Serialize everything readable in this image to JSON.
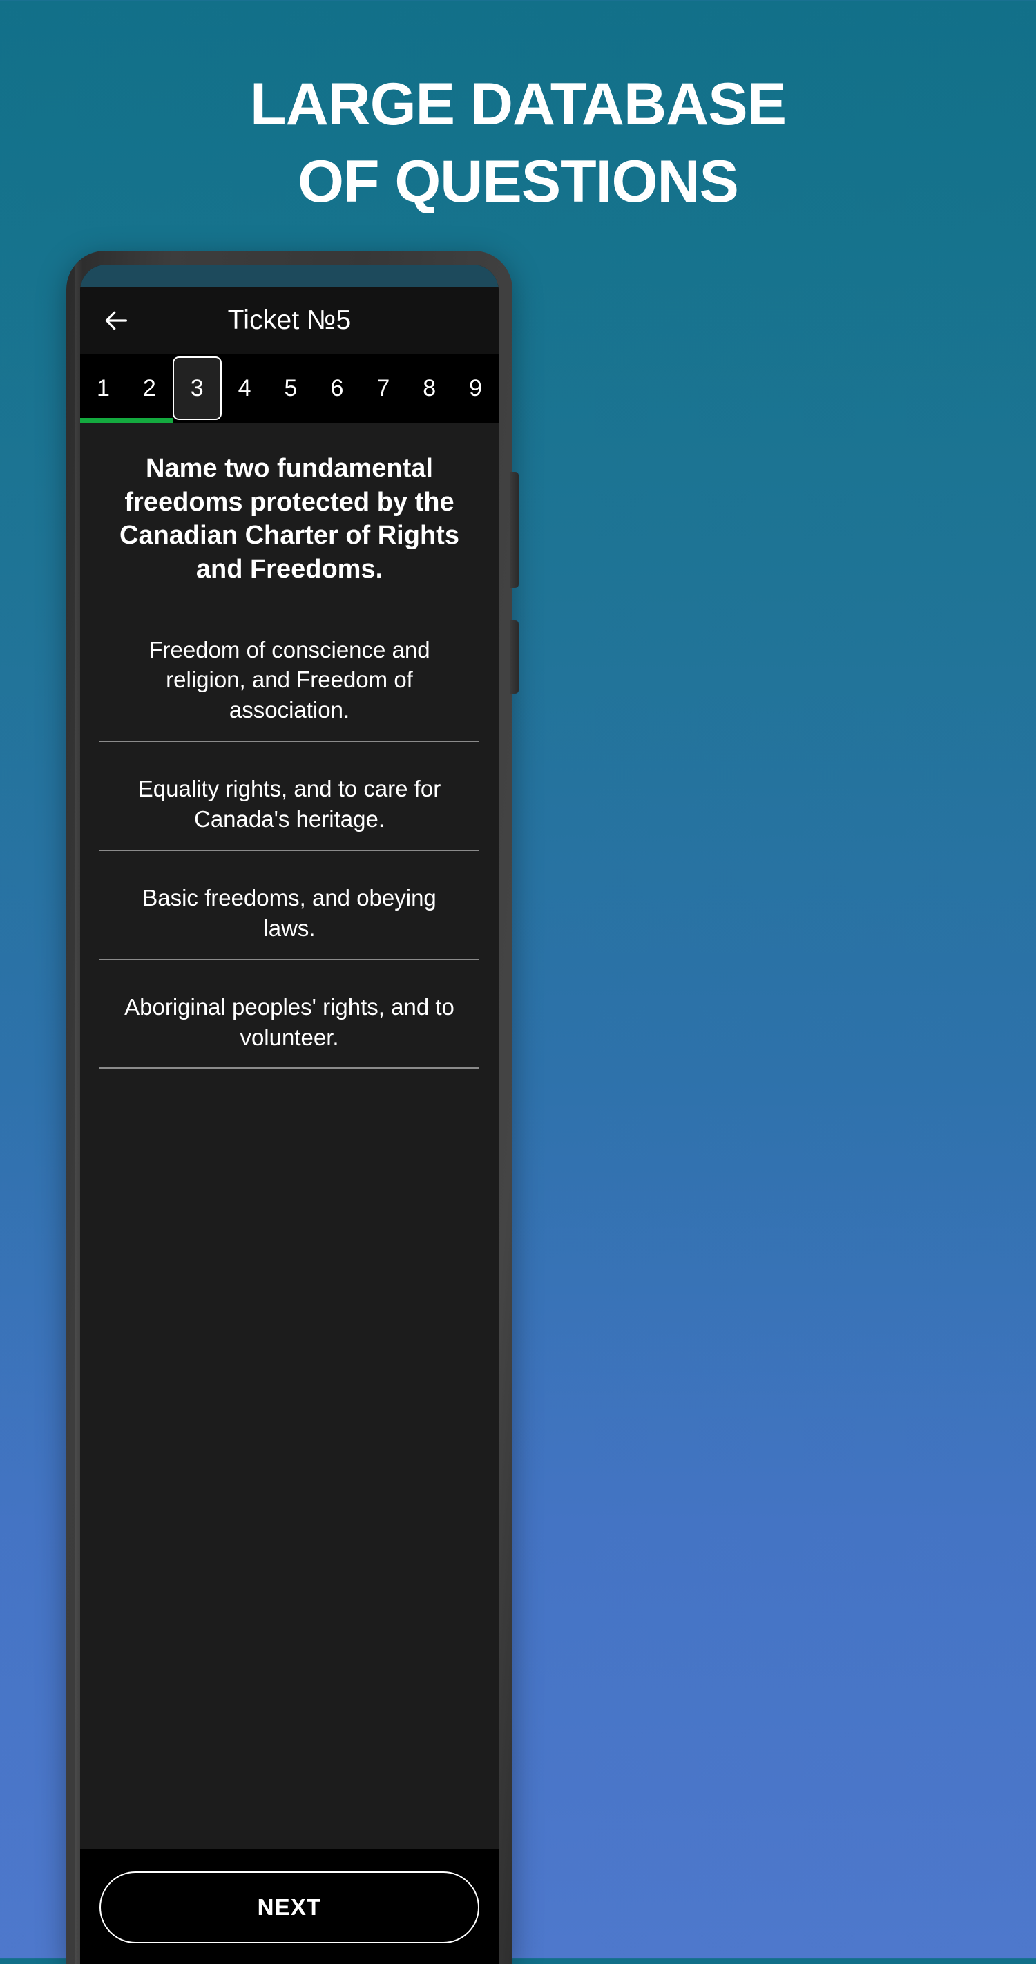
{
  "promo": {
    "headline_line1": "LARGE DATABASE",
    "headline_line2": "OF QUESTIONS",
    "background_top_color": "#127089",
    "background_bottom_color": "#4e78cc"
  },
  "app": {
    "appbar": {
      "back_icon": "arrow-left-icon",
      "title": "Ticket №5"
    },
    "tabs": {
      "items": [
        "1",
        "2",
        "3",
        "4",
        "5",
        "6",
        "7",
        "8",
        "9"
      ],
      "selected_index": 2,
      "progress_percent": 22.2,
      "progress_color": "#14aa3f"
    },
    "question": {
      "text": "Name two fundamental freedoms protected by the Canadian Charter of Rights and Freedoms."
    },
    "answers": [
      {
        "text": "Freedom of conscience and religion, and Freedom of association."
      },
      {
        "text": "Equality rights, and to care for Canada's heritage."
      },
      {
        "text": "Basic freedoms, and obeying laws."
      },
      {
        "text": "Aboriginal peoples' rights, and to volunteer."
      }
    ],
    "footer": {
      "next_label": "NEXT"
    }
  }
}
